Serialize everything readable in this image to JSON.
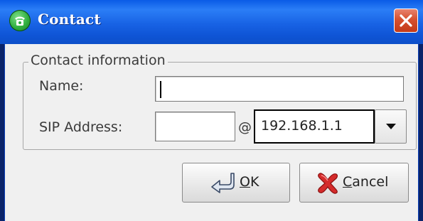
{
  "window": {
    "title": "Contact"
  },
  "group": {
    "title": "Contact information"
  },
  "fields": {
    "name_label": "Name:",
    "name_value": "",
    "sip_label": "SIP Address:",
    "sip_user_value": "",
    "at": "@",
    "sip_host_value": "192.168.1.1"
  },
  "buttons": {
    "ok": {
      "mnemonic": "O",
      "rest": "K"
    },
    "cancel": {
      "mnemonic": "C",
      "rest": "ancel"
    }
  },
  "icons": {
    "app": "phone-icon",
    "close": "close-icon",
    "dropdown": "chevron-down-icon",
    "ok": "enter-arrow-icon",
    "cancel": "red-x-icon"
  },
  "colors": {
    "titlebar": "#1862e4",
    "close": "#d6502f",
    "client_bg": "#f0f0f0"
  }
}
